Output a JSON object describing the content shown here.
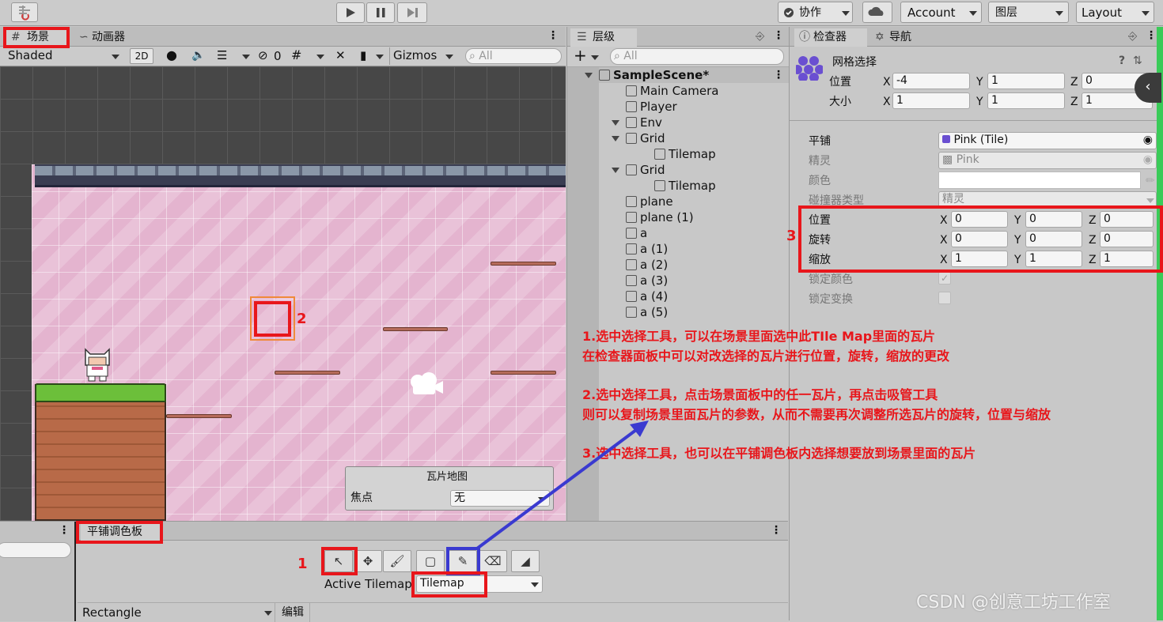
{
  "toolbar": {
    "collab": "协作",
    "account": "Account",
    "layers": "图层",
    "layout": "Layout"
  },
  "scene_panel": {
    "tab_scene": "场景",
    "tab_animator": "动画器",
    "shading": "Shaded",
    "mode_2d": "2D",
    "hidden_count": "0",
    "gizmos": "Gizmos",
    "search_placeholder": "All"
  },
  "tilemap_overlay": {
    "title": "瓦片地图",
    "focus_label": "焦点",
    "focus_value": "无"
  },
  "hierarchy": {
    "tab": "层级",
    "search_placeholder": "All",
    "items": [
      {
        "label": "SampleScene*",
        "indent": 0,
        "bold": true
      },
      {
        "label": "Main Camera",
        "indent": 1
      },
      {
        "label": "Player",
        "indent": 1
      },
      {
        "label": "Env",
        "indent": 1
      },
      {
        "label": "Grid",
        "indent": 2
      },
      {
        "label": "Tilemap",
        "indent": 3
      },
      {
        "label": "Grid",
        "indent": 2
      },
      {
        "label": "Tilemap",
        "indent": 3
      },
      {
        "label": "plane",
        "indent": 2
      },
      {
        "label": "plane (1)",
        "indent": 2
      },
      {
        "label": "a",
        "indent": 2
      },
      {
        "label": "a (1)",
        "indent": 2
      },
      {
        "label": "a (2)",
        "indent": 2
      },
      {
        "label": "a (3)",
        "indent": 2
      },
      {
        "label": "a (4)",
        "indent": 2
      },
      {
        "label": "a (5)",
        "indent": 2
      }
    ]
  },
  "inspector": {
    "tab_inspector": "检查器",
    "tab_navigation": "导航",
    "title": "网格选择",
    "pos_label": "位置",
    "size_label": "大小",
    "pos": {
      "x": "-4",
      "y": "1",
      "z": "0"
    },
    "size": {
      "x": "1",
      "y": "1",
      "z": "1"
    },
    "tile_label": "平铺",
    "tile_value": "Pink (Tile)",
    "sprite_label": "精灵",
    "sprite_value": "Pink",
    "color_label": "颜色",
    "collider_label": "碰撞器类型",
    "collider_value": "精灵",
    "position_label": "位置",
    "rotation_label": "旋转",
    "scale_label": "缩放",
    "position": {
      "x": "0",
      "y": "0",
      "z": "0"
    },
    "rotation": {
      "x": "0",
      "y": "0",
      "z": "0"
    },
    "scale": {
      "x": "1",
      "y": "1",
      "z": "1"
    },
    "lock_color": "锁定颜色",
    "lock_transform": "锁定变换"
  },
  "axis": {
    "x": "X",
    "y": "Y",
    "z": "Z"
  },
  "palette": {
    "tab": "平铺调色板",
    "active_tilemap_label": "Active Tilemap",
    "active_tilemap_value": "Tilemap",
    "brush": "Rectangle",
    "edit": "编辑"
  },
  "annotations": {
    "n1": "1",
    "n2": "2",
    "n3": "3",
    "line1a": "1.选中选择工具，可以在场景里面选中此TIle Map里面的瓦片",
    "line1b": "在检查器面板中可以对改选择的瓦片进行位置，旋转，缩放的更改",
    "line2a": "2.选中选择工具，点击场景面板中的任一瓦片，再点击吸管工具",
    "line2b": "则可以复制场景里面瓦片的参数，从而不需要再次调整所选瓦片的旋转，位置与缩放",
    "line3": "3.选中选择工具，也可以在平铺调色板内选择想要放到场景里面的瓦片"
  },
  "watermark": "CSDN @创意工坊工作室",
  "colors": {
    "annotation_red": "#e8161b",
    "arrow_blue": "#3a3ad0",
    "scene_pink": "#e4b4cf"
  }
}
